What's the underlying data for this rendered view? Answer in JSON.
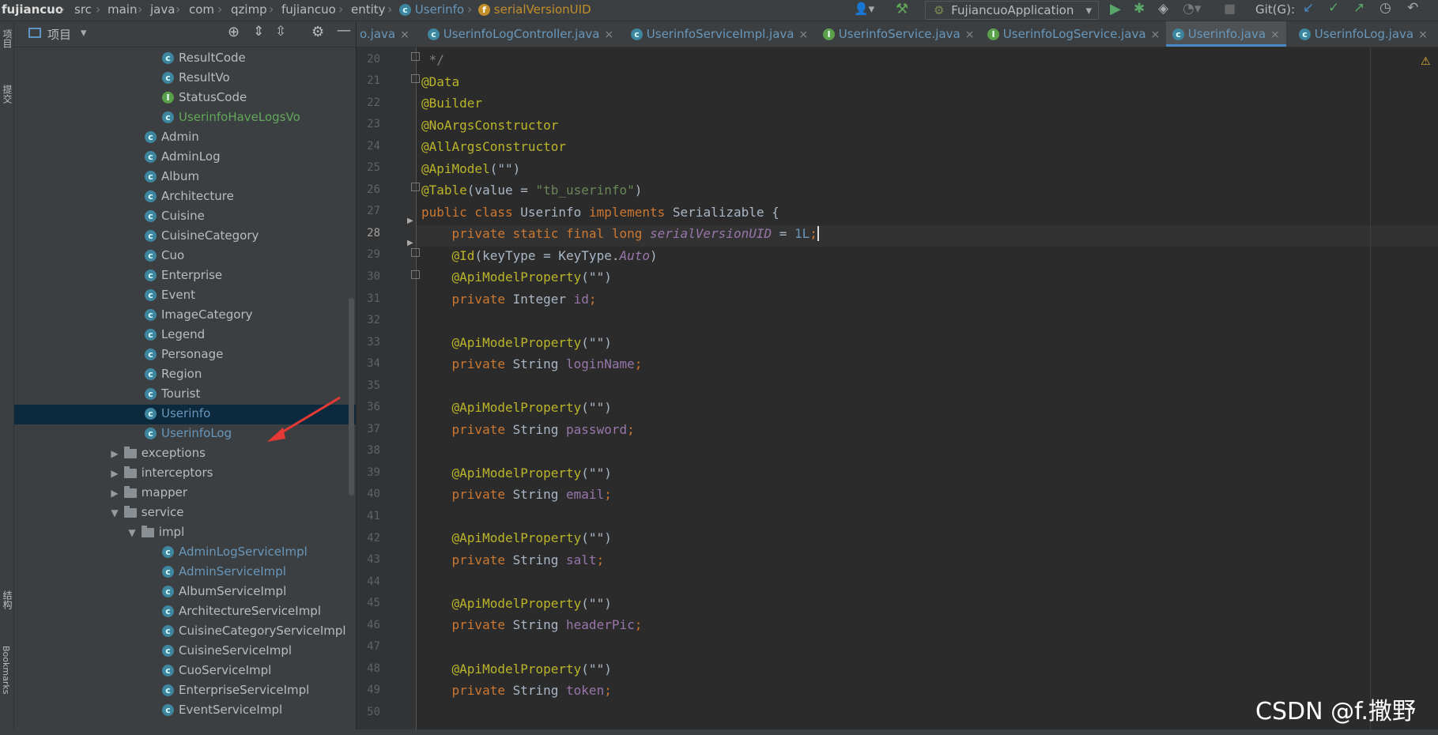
{
  "breadcrumb": {
    "items": [
      "fujiancuo",
      "src",
      "main",
      "java",
      "com",
      "qzimp",
      "fujiancuo",
      "entity",
      "Userinfo",
      "serialVersionUID"
    ]
  },
  "toolbar": {
    "run_config": "FujiancuoApplication",
    "git_label": "Git(G):"
  },
  "side_strip": {
    "top_label": "项目",
    "commit_label": "提交",
    "structure_label": "结构",
    "bookmarks_label": "Bookmarks"
  },
  "project_panel": {
    "title": "项目",
    "tree": [
      {
        "label": "ResultCode",
        "kind": "class"
      },
      {
        "label": "ResultVo",
        "kind": "class"
      },
      {
        "label": "StatusCode",
        "kind": "interface"
      },
      {
        "label": "UserinfoHaveLogsVo",
        "kind": "class"
      },
      {
        "label": "Admin",
        "kind": "class"
      },
      {
        "label": "AdminLog",
        "kind": "class"
      },
      {
        "label": "Album",
        "kind": "class"
      },
      {
        "label": "Architecture",
        "kind": "class"
      },
      {
        "label": "Cuisine",
        "kind": "class"
      },
      {
        "label": "CuisineCategory",
        "kind": "class"
      },
      {
        "label": "Cuo",
        "kind": "class"
      },
      {
        "label": "Enterprise",
        "kind": "class"
      },
      {
        "label": "Event",
        "kind": "class"
      },
      {
        "label": "ImageCategory",
        "kind": "class"
      },
      {
        "label": "Legend",
        "kind": "class"
      },
      {
        "label": "Personage",
        "kind": "class"
      },
      {
        "label": "Region",
        "kind": "class"
      },
      {
        "label": "Tourist",
        "kind": "class"
      },
      {
        "label": "Userinfo",
        "kind": "class"
      },
      {
        "label": "UserinfoLog",
        "kind": "class"
      },
      {
        "label": "exceptions",
        "kind": "folder"
      },
      {
        "label": "interceptors",
        "kind": "folder"
      },
      {
        "label": "mapper",
        "kind": "folder"
      },
      {
        "label": "service",
        "kind": "folder"
      },
      {
        "label": "impl",
        "kind": "folder"
      },
      {
        "label": "AdminLogServiceImpl",
        "kind": "class"
      },
      {
        "label": "AdminServiceImpl",
        "kind": "class"
      },
      {
        "label": "AlbumServiceImpl",
        "kind": "class"
      },
      {
        "label": "ArchitectureServiceImpl",
        "kind": "class"
      },
      {
        "label": "CuisineCategoryServiceImpl",
        "kind": "class"
      },
      {
        "label": "CuisineServiceImpl",
        "kind": "class"
      },
      {
        "label": "CuoServiceImpl",
        "kind": "class"
      },
      {
        "label": "EnterpriseServiceImpl",
        "kind": "class"
      },
      {
        "label": "EventServiceImpl",
        "kind": "class"
      }
    ]
  },
  "tabs": [
    {
      "label": "o.java"
    },
    {
      "label": "UserinfoLogController.java"
    },
    {
      "label": "UserinfoServiceImpl.java"
    },
    {
      "label": "UserinfoService.java"
    },
    {
      "label": "UserinfoLogService.java"
    },
    {
      "label": "Userinfo.java"
    },
    {
      "label": "UserinfoLog.java"
    }
  ],
  "editor": {
    "line_numbers": [
      "20",
      "21",
      "22",
      "23",
      "24",
      "25",
      "26",
      "27",
      "28",
      "29",
      "30",
      "31",
      "32",
      "33",
      "34",
      "35",
      "36",
      "37",
      "38",
      "39",
      "40",
      "41",
      "42",
      "43",
      "44",
      "45",
      "46",
      "47",
      "48",
      "49",
      "50"
    ],
    "current_line": "28",
    "code": {
      "l20": " */",
      "l21": "@Data",
      "l22": "@Builder",
      "l23": "@NoArgsConstructor",
      "l24": "@AllArgsConstructor",
      "l25a": "@ApiModel",
      "l25b": "(\"\")",
      "l26a": "@Table",
      "l26b": "(value = ",
      "l26c": "\"tb_userinfo\"",
      "l26d": ")",
      "l27a": "public class ",
      "l27b": "Userinfo ",
      "l27c": "implements ",
      "l27d": "Serializable {",
      "l28a": "    private static final long ",
      "l28b": "serialVersionUID",
      "l28c": " = ",
      "l28d": "1L",
      "l28e": ";",
      "l29a": "    @Id",
      "l29b": "(keyType = KeyType.",
      "l29c": "Auto",
      "l29d": ")",
      "api": "    @ApiModelProperty",
      "api_args": "(\"\")",
      "priv": "    private ",
      "l31_type": "Integer ",
      "l31_f": "id",
      "semi": ";",
      "str_type": "String ",
      "l34_f": "loginName",
      "l37_f": "password",
      "l40_f": "email",
      "l43_f": "salt",
      "l46_f": "headerPic",
      "l49_f": "token"
    }
  },
  "watermark": "CSDN @f.撒野"
}
